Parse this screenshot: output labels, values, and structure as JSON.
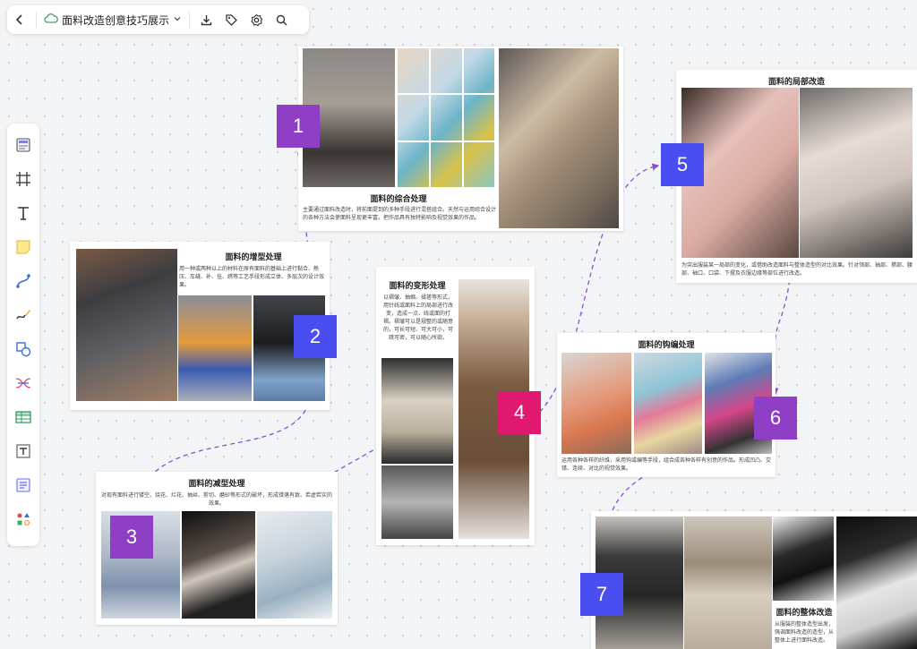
{
  "toolbar": {
    "doc_title": "面料改造创意技巧展示",
    "icons": [
      "back-arrow-icon",
      "cloud-icon",
      "chevron-down-icon",
      "download-icon",
      "tag-icon",
      "settings-icon",
      "search-icon"
    ]
  },
  "left_tools": [
    "template-icon",
    "frame-icon",
    "text-icon",
    "sticky-note-icon",
    "connector-icon",
    "pen-icon",
    "shape-icon",
    "mindmap-icon",
    "table-icon",
    "text-block-icon",
    "list-icon",
    "more-shapes-icon"
  ],
  "colors": {
    "purple": "#8e3fc6",
    "blue": "#4a4df0",
    "pink": "#e0186f",
    "connector": "#8a4fd4"
  },
  "cards": {
    "c1": {
      "title": "面料的综合处理",
      "text": "主要通过面料改造时，将前面提到的多种手段进行混搭组合。天然与运用综合设计的各种方法会使面料呈现更丰富。把作品具有独特影响及视觉效果的作品。"
    },
    "c2": {
      "title": "面料的增型处理",
      "text": "用一种或两种以上的材料在原有面料的基础上进行黏合、熱压、车缝、补、挂、绣等工艺手段形成立体、多层次的设计效果。"
    },
    "c3": {
      "title": "面料的减型处理",
      "text": "对现有面料进行镂空、烧花、烂花、抽丝、剪切、磨砂等形式的破坏，形成错落有致、若虚若实的效果。"
    },
    "c4": {
      "title": "面料的变形处理",
      "text": "以褶皱、抽缩、揉搓等形式，用针线或面料上的局部进行改变，造成一点、线或面的打褶。褶皱可以是规整的或随意的，可长可短、可大可小，可疏可密，可以随心所欲。"
    },
    "c5": {
      "title": "面料的局部改造",
      "text": "为突出服装某一局部的变化，或借助改造面料与整体造型的对比效果。针对领部、袖部、襟部、腰部、袖口、口袋、下摆及衣服边缘等部位进行改造。"
    },
    "c6": {
      "title": "面料的钩编处理",
      "text": "运用各种各样的纤维，采用钩或编等手段，组合成各种各样有创意的作品。形成凹凸、交错、连续、对比的视觉效果。"
    },
    "c7": {
      "title": "面料的整体改造",
      "text": "从服装的整体造型出发，强调面料改造的造型，从整体上进行面料改造。"
    }
  },
  "badges": [
    {
      "label": "1",
      "color": "#8e3fc6"
    },
    {
      "label": "2",
      "color": "#4a4df0"
    },
    {
      "label": "3",
      "color": "#8e3fc6"
    },
    {
      "label": "4",
      "color": "#e0186f"
    },
    {
      "label": "5",
      "color": "#4a4df0"
    },
    {
      "label": "6",
      "color": "#8e3fc6"
    },
    {
      "label": "7",
      "color": "#4a4df0"
    }
  ]
}
